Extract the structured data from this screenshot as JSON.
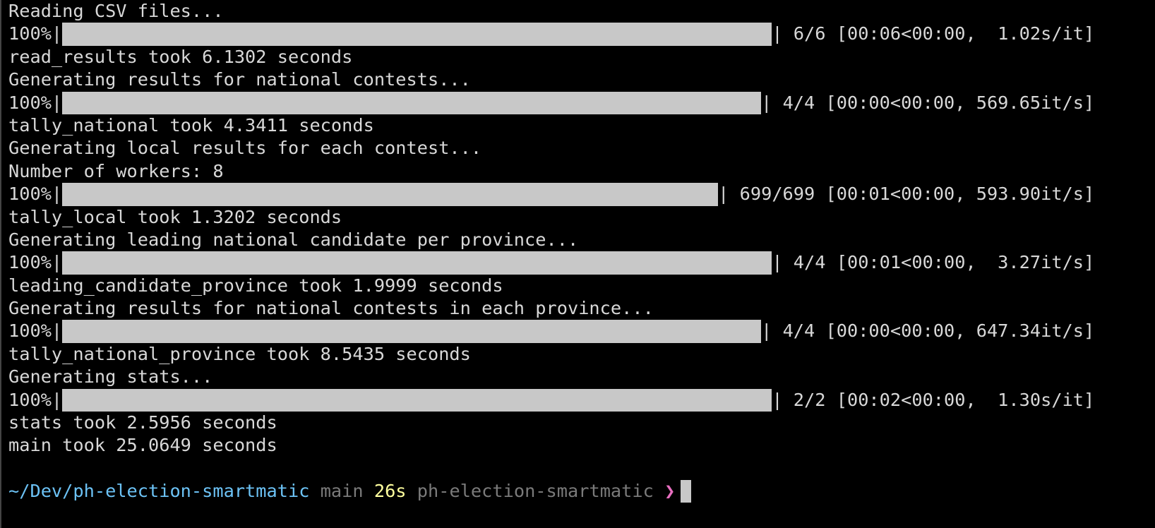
{
  "lines": [
    {
      "text": "Reading CSV files..."
    },
    {
      "progress": {
        "percent_label": "100%",
        "value": 100,
        "counter": "6/6",
        "timing": "[00:06<00:00,  1.02s/it]"
      }
    },
    {
      "text": "read_results took 6.1302 seconds"
    },
    {
      "text": "Generating results for national contests..."
    },
    {
      "progress": {
        "percent_label": "100%",
        "value": 100,
        "counter": "4/4",
        "timing": "[00:00<00:00, 569.65it/s]"
      }
    },
    {
      "text": "tally_national took 4.3411 seconds"
    },
    {
      "text": "Generating local results for each contest..."
    },
    {
      "text": "Number of workers: 8"
    },
    {
      "progress": {
        "percent_label": "100%",
        "value": 100,
        "counter": "699/699",
        "timing": "[00:01<00:00, 593.90it/s]"
      }
    },
    {
      "text": "tally_local took 1.3202 seconds"
    },
    {
      "text": "Generating leading national candidate per province..."
    },
    {
      "progress": {
        "percent_label": "100%",
        "value": 100,
        "counter": "4/4",
        "timing": "[00:01<00:00,  3.27it/s]"
      }
    },
    {
      "text": "leading_candidate_province took 1.9999 seconds"
    },
    {
      "text": "Generating results for national contests in each province..."
    },
    {
      "progress": {
        "percent_label": "100%",
        "value": 100,
        "counter": "4/4",
        "timing": "[00:00<00:00, 647.34it/s]"
      }
    },
    {
      "text": "tally_national_province took 8.5435 seconds"
    },
    {
      "text": "Generating stats..."
    },
    {
      "progress": {
        "percent_label": "100%",
        "value": 100,
        "counter": "2/2",
        "timing": "[00:02<00:00,  1.30s/it]"
      }
    },
    {
      "text": "stats took 2.5956 seconds"
    },
    {
      "text": "main took 25.0649 seconds"
    }
  ],
  "prompt": {
    "path": "~/Dev/ph-election-smartmatic",
    "branch": "main",
    "duration": "26s",
    "project": "ph-election-smartmatic",
    "symbol": "❯",
    "colors": {
      "path": "#6cc2f5",
      "branch": "#7a7a7a",
      "duration": "#ffff9e",
      "symbol": "#e86fc0"
    }
  },
  "progress_bar_color": "#c8c8c8"
}
